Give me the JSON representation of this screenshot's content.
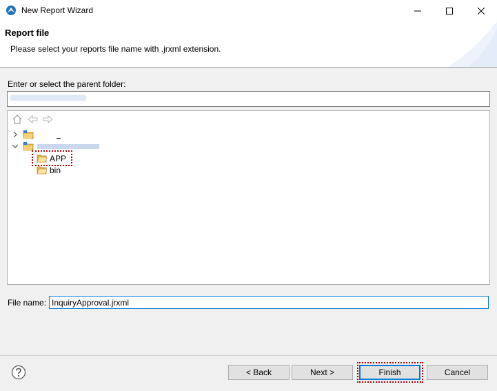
{
  "window": {
    "title": "New Report Wizard",
    "minimize_icon": "minimize-icon",
    "maximize_icon": "maximize-icon",
    "close_icon": "close-icon"
  },
  "banner": {
    "title": "Report file",
    "description": "Please select your reports file name with .jrxml extension."
  },
  "parent_folder": {
    "label": "Enter or select the parent folder:",
    "value": ""
  },
  "tree": {
    "toolbar": [
      "home-icon",
      "back-arrow-icon",
      "forward-arrow-icon"
    ],
    "items": [
      {
        "label": "",
        "expanded": false,
        "level": 0,
        "icon": "project-folder-icon"
      },
      {
        "label": "",
        "expanded": true,
        "level": 0,
        "icon": "project-folder-icon"
      },
      {
        "label": "APP",
        "level": 1,
        "icon": "folder-icon",
        "highlighted": true
      },
      {
        "label": "bin",
        "level": 1,
        "icon": "folder-icon"
      }
    ]
  },
  "file_name": {
    "label": "File name:",
    "value": "InquiryApproval.jrxml"
  },
  "buttons": {
    "back": "< Back",
    "next": "Next >",
    "finish": "Finish",
    "cancel": "Cancel"
  },
  "colors": {
    "accent": "#0078d7",
    "highlight_border": "#c00000",
    "folder": "#e8b54a"
  }
}
